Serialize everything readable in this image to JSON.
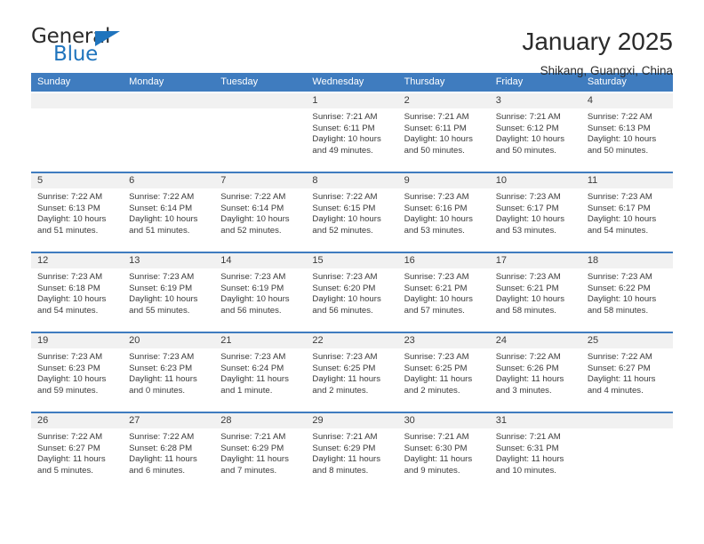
{
  "logo": {
    "primary_text": "General",
    "secondary_text": "Blue",
    "triangle_icon": "triangle-icon",
    "brand_color": "#1f74bd"
  },
  "header": {
    "title": "January 2025",
    "subtitle": "Shikang, Guangxi, China"
  },
  "calendar": {
    "header_bg": "#3f7cbf",
    "cell_head_bg": "#f1f1f1",
    "weekdays": [
      "Sunday",
      "Monday",
      "Tuesday",
      "Wednesday",
      "Thursday",
      "Friday",
      "Saturday"
    ],
    "weeks": [
      [
        {
          "day": "",
          "empty": true
        },
        {
          "day": "",
          "empty": true
        },
        {
          "day": "",
          "empty": true
        },
        {
          "day": "1",
          "sunrise": "Sunrise: 7:21 AM",
          "sunset": "Sunset: 6:11 PM",
          "daylight_line1": "Daylight: 10 hours",
          "daylight_line2": "and 49 minutes."
        },
        {
          "day": "2",
          "sunrise": "Sunrise: 7:21 AM",
          "sunset": "Sunset: 6:11 PM",
          "daylight_line1": "Daylight: 10 hours",
          "daylight_line2": "and 50 minutes."
        },
        {
          "day": "3",
          "sunrise": "Sunrise: 7:21 AM",
          "sunset": "Sunset: 6:12 PM",
          "daylight_line1": "Daylight: 10 hours",
          "daylight_line2": "and 50 minutes."
        },
        {
          "day": "4",
          "sunrise": "Sunrise: 7:22 AM",
          "sunset": "Sunset: 6:13 PM",
          "daylight_line1": "Daylight: 10 hours",
          "daylight_line2": "and 50 minutes."
        }
      ],
      [
        {
          "day": "5",
          "sunrise": "Sunrise: 7:22 AM",
          "sunset": "Sunset: 6:13 PM",
          "daylight_line1": "Daylight: 10 hours",
          "daylight_line2": "and 51 minutes."
        },
        {
          "day": "6",
          "sunrise": "Sunrise: 7:22 AM",
          "sunset": "Sunset: 6:14 PM",
          "daylight_line1": "Daylight: 10 hours",
          "daylight_line2": "and 51 minutes."
        },
        {
          "day": "7",
          "sunrise": "Sunrise: 7:22 AM",
          "sunset": "Sunset: 6:14 PM",
          "daylight_line1": "Daylight: 10 hours",
          "daylight_line2": "and 52 minutes."
        },
        {
          "day": "8",
          "sunrise": "Sunrise: 7:22 AM",
          "sunset": "Sunset: 6:15 PM",
          "daylight_line1": "Daylight: 10 hours",
          "daylight_line2": "and 52 minutes."
        },
        {
          "day": "9",
          "sunrise": "Sunrise: 7:23 AM",
          "sunset": "Sunset: 6:16 PM",
          "daylight_line1": "Daylight: 10 hours",
          "daylight_line2": "and 53 minutes."
        },
        {
          "day": "10",
          "sunrise": "Sunrise: 7:23 AM",
          "sunset": "Sunset: 6:17 PM",
          "daylight_line1": "Daylight: 10 hours",
          "daylight_line2": "and 53 minutes."
        },
        {
          "day": "11",
          "sunrise": "Sunrise: 7:23 AM",
          "sunset": "Sunset: 6:17 PM",
          "daylight_line1": "Daylight: 10 hours",
          "daylight_line2": "and 54 minutes."
        }
      ],
      [
        {
          "day": "12",
          "sunrise": "Sunrise: 7:23 AM",
          "sunset": "Sunset: 6:18 PM",
          "daylight_line1": "Daylight: 10 hours",
          "daylight_line2": "and 54 minutes."
        },
        {
          "day": "13",
          "sunrise": "Sunrise: 7:23 AM",
          "sunset": "Sunset: 6:19 PM",
          "daylight_line1": "Daylight: 10 hours",
          "daylight_line2": "and 55 minutes."
        },
        {
          "day": "14",
          "sunrise": "Sunrise: 7:23 AM",
          "sunset": "Sunset: 6:19 PM",
          "daylight_line1": "Daylight: 10 hours",
          "daylight_line2": "and 56 minutes."
        },
        {
          "day": "15",
          "sunrise": "Sunrise: 7:23 AM",
          "sunset": "Sunset: 6:20 PM",
          "daylight_line1": "Daylight: 10 hours",
          "daylight_line2": "and 56 minutes."
        },
        {
          "day": "16",
          "sunrise": "Sunrise: 7:23 AM",
          "sunset": "Sunset: 6:21 PM",
          "daylight_line1": "Daylight: 10 hours",
          "daylight_line2": "and 57 minutes."
        },
        {
          "day": "17",
          "sunrise": "Sunrise: 7:23 AM",
          "sunset": "Sunset: 6:21 PM",
          "daylight_line1": "Daylight: 10 hours",
          "daylight_line2": "and 58 minutes."
        },
        {
          "day": "18",
          "sunrise": "Sunrise: 7:23 AM",
          "sunset": "Sunset: 6:22 PM",
          "daylight_line1": "Daylight: 10 hours",
          "daylight_line2": "and 58 minutes."
        }
      ],
      [
        {
          "day": "19",
          "sunrise": "Sunrise: 7:23 AM",
          "sunset": "Sunset: 6:23 PM",
          "daylight_line1": "Daylight: 10 hours",
          "daylight_line2": "and 59 minutes."
        },
        {
          "day": "20",
          "sunrise": "Sunrise: 7:23 AM",
          "sunset": "Sunset: 6:23 PM",
          "daylight_line1": "Daylight: 11 hours",
          "daylight_line2": "and 0 minutes."
        },
        {
          "day": "21",
          "sunrise": "Sunrise: 7:23 AM",
          "sunset": "Sunset: 6:24 PM",
          "daylight_line1": "Daylight: 11 hours",
          "daylight_line2": "and 1 minute."
        },
        {
          "day": "22",
          "sunrise": "Sunrise: 7:23 AM",
          "sunset": "Sunset: 6:25 PM",
          "daylight_line1": "Daylight: 11 hours",
          "daylight_line2": "and 2 minutes."
        },
        {
          "day": "23",
          "sunrise": "Sunrise: 7:23 AM",
          "sunset": "Sunset: 6:25 PM",
          "daylight_line1": "Daylight: 11 hours",
          "daylight_line2": "and 2 minutes."
        },
        {
          "day": "24",
          "sunrise": "Sunrise: 7:22 AM",
          "sunset": "Sunset: 6:26 PM",
          "daylight_line1": "Daylight: 11 hours",
          "daylight_line2": "and 3 minutes."
        },
        {
          "day": "25",
          "sunrise": "Sunrise: 7:22 AM",
          "sunset": "Sunset: 6:27 PM",
          "daylight_line1": "Daylight: 11 hours",
          "daylight_line2": "and 4 minutes."
        }
      ],
      [
        {
          "day": "26",
          "sunrise": "Sunrise: 7:22 AM",
          "sunset": "Sunset: 6:27 PM",
          "daylight_line1": "Daylight: 11 hours",
          "daylight_line2": "and 5 minutes."
        },
        {
          "day": "27",
          "sunrise": "Sunrise: 7:22 AM",
          "sunset": "Sunset: 6:28 PM",
          "daylight_line1": "Daylight: 11 hours",
          "daylight_line2": "and 6 minutes."
        },
        {
          "day": "28",
          "sunrise": "Sunrise: 7:21 AM",
          "sunset": "Sunset: 6:29 PM",
          "daylight_line1": "Daylight: 11 hours",
          "daylight_line2": "and 7 minutes."
        },
        {
          "day": "29",
          "sunrise": "Sunrise: 7:21 AM",
          "sunset": "Sunset: 6:29 PM",
          "daylight_line1": "Daylight: 11 hours",
          "daylight_line2": "and 8 minutes."
        },
        {
          "day": "30",
          "sunrise": "Sunrise: 7:21 AM",
          "sunset": "Sunset: 6:30 PM",
          "daylight_line1": "Daylight: 11 hours",
          "daylight_line2": "and 9 minutes."
        },
        {
          "day": "31",
          "sunrise": "Sunrise: 7:21 AM",
          "sunset": "Sunset: 6:31 PM",
          "daylight_line1": "Daylight: 11 hours",
          "daylight_line2": "and 10 minutes."
        },
        {
          "day": "",
          "empty": true
        }
      ]
    ]
  }
}
